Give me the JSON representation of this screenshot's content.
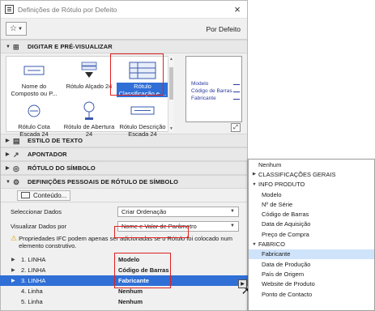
{
  "window": {
    "title": "Definições de Rótulo por Defeito",
    "close_glyph": "×"
  },
  "toolbar": {
    "favorites_glyph": "☆",
    "default_label": "Por Defeito"
  },
  "sections": {
    "digitar": "DIGITAR E PRÉ-VISUALIZAR",
    "estilo": "ESTILO DE TEXTO",
    "apontador": "APONTADOR",
    "simbolo": "RÓTULO DO SÍMBOLO",
    "definicoes": "DEFINIÇÕES PESSOAIS DE RÓTULO DE SÍMBOLO"
  },
  "gallery": {
    "items": [
      {
        "label": "Nome do Composto ou P..."
      },
      {
        "label": "Rótulo Alçado 24"
      },
      {
        "label": "Rótulo Classificação e ..."
      },
      {
        "label": "Rótulo Cota Escada 24"
      },
      {
        "label": "Rótulo de Abertura 24"
      },
      {
        "label": "Rótulo Descrição Escada 24"
      }
    ],
    "selected_index": 2
  },
  "preview": {
    "lines": [
      "Modelo",
      "Código de Barras",
      "Fabricante"
    ]
  },
  "content_button": "Conteúdo...",
  "fields": {
    "select_data_label": "Seleccionar Dados",
    "select_data_value": "Criar Ordenação",
    "view_data_label": "Visualizar Dados por",
    "view_data_value": "Nome e Valor de Parâmetro"
  },
  "warning": "Propriedades IFC podem apenas ser adicionadas se o Rótulo foi colocado num elemento construtivo.",
  "rows": [
    {
      "label": "1. LINHA",
      "value": "Modelo"
    },
    {
      "label": "2. LINHA",
      "value": "Código de Barras"
    },
    {
      "label": "3. LINHA",
      "value": "Fabricante"
    },
    {
      "label": "4. Linha",
      "value": "Nenhum"
    },
    {
      "label": "5. Linha",
      "value": "Nenhum"
    }
  ],
  "menu": [
    {
      "label": "Nenhum",
      "level": 0,
      "arrow": ""
    },
    {
      "label": "CLASSIFICAÇÕES GERAIS",
      "level": 0,
      "arrow": "▶"
    },
    {
      "label": "INFO PRODUTO",
      "level": 0,
      "arrow": "▼"
    },
    {
      "label": "Modelo",
      "level": 1,
      "arrow": ""
    },
    {
      "label": "Nº de Série",
      "level": 1,
      "arrow": ""
    },
    {
      "label": "Código de Barras",
      "level": 1,
      "arrow": ""
    },
    {
      "label": "Data de Aquisição",
      "level": 1,
      "arrow": ""
    },
    {
      "label": "Preço de Compra",
      "level": 1,
      "arrow": ""
    },
    {
      "label": "FABRICO",
      "level": 0,
      "arrow": "▼"
    },
    {
      "label": "Fabricante",
      "level": 1,
      "arrow": "",
      "highlighted": true
    },
    {
      "label": "Data de Produção",
      "level": 1,
      "arrow": ""
    },
    {
      "label": "País de Origem",
      "level": 1,
      "arrow": ""
    },
    {
      "label": "Website de Produto",
      "level": 1,
      "arrow": ""
    },
    {
      "label": "Ponto de Contacto",
      "level": 1,
      "arrow": ""
    }
  ],
  "colors": {
    "selection": "#2f6fd6",
    "highlight_box": "#e02020",
    "menu_hover": "#cfe3fb",
    "preview_text": "#2a3a9e"
  }
}
